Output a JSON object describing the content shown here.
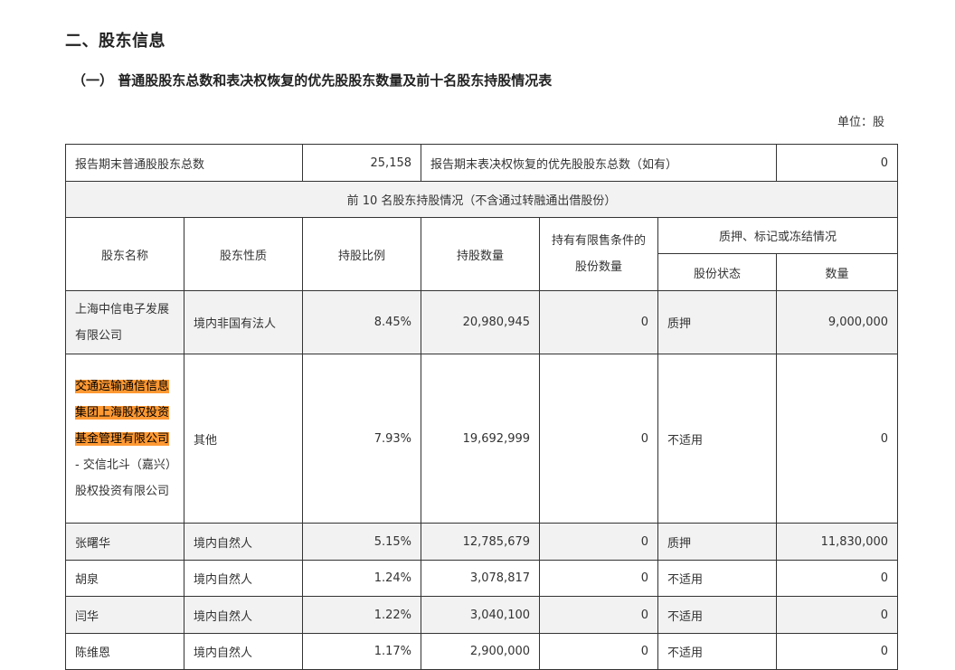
{
  "section_title": "二、股东信息",
  "subsection_title": "（一） 普通股股东总数和表决权恢复的优先股股东数量及前十名股东持股情况表",
  "unit": "单位：股",
  "summary": {
    "common_label": "报告期末普通股股东总数",
    "common_value": "25,158",
    "pref_label": "报告期末表决权恢复的优先股股东总数（如有）",
    "pref_value": "0"
  },
  "top10_caption": "前 10 名股东持股情况（不含通过转融通出借股份）",
  "headers": {
    "name": "股东名称",
    "nature": "股东性质",
    "ratio": "持股比例",
    "quantity": "持股数量",
    "restricted": "持有有限售条件的股份数量",
    "pledge_group": "质押、标记或冻结情况",
    "status": "股份状态",
    "amount": "数量"
  },
  "rows": [
    {
      "name": "上海中信电子发展有限公司",
      "nature": "境内非国有法人",
      "ratio": "8.45%",
      "quantity": "20,980,945",
      "restricted": "0",
      "status": "质押",
      "amount": "9,000,000"
    },
    {
      "name_highlight": "交通运输通信信息集团上海股权投资基金管理有限公司",
      "name_rest": " - 交信北斗（嘉兴）股权投资有限公司",
      "nature": "其他",
      "ratio": "7.93%",
      "quantity": "19,692,999",
      "restricted": "0",
      "status": "不适用",
      "amount": "0"
    },
    {
      "name": "张曙华",
      "nature": "境内自然人",
      "ratio": "5.15%",
      "quantity": "12,785,679",
      "restricted": "0",
      "status": "质押",
      "amount": "11,830,000"
    },
    {
      "name": "胡泉",
      "nature": "境内自然人",
      "ratio": "1.24%",
      "quantity": "3,078,817",
      "restricted": "0",
      "status": "不适用",
      "amount": "0"
    },
    {
      "name": "闫华",
      "nature": "境内自然人",
      "ratio": "1.22%",
      "quantity": "3,040,100",
      "restricted": "0",
      "status": "不适用",
      "amount": "0"
    },
    {
      "name": "陈维恩",
      "nature": "境内自然人",
      "ratio": "1.17%",
      "quantity": "2,900,000",
      "restricted": "0",
      "status": "不适用",
      "amount": "0"
    }
  ]
}
